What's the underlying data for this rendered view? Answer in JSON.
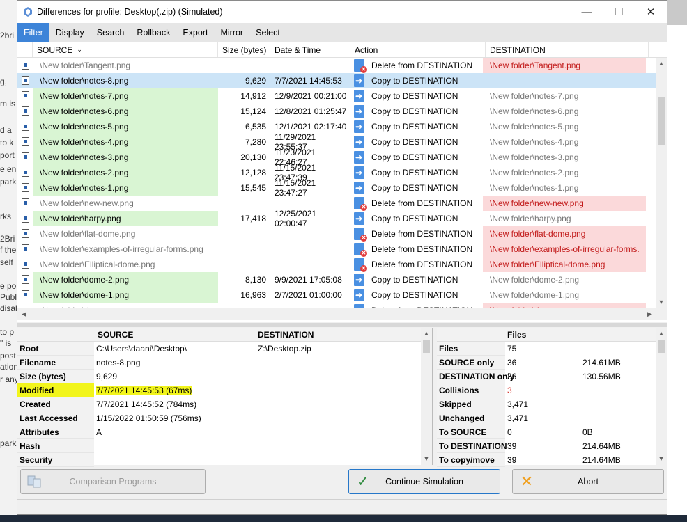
{
  "window": {
    "title": "Differences for profile: Desktop(.zip) (Simulated)",
    "minimize": "—",
    "maximize": "☐",
    "close": "✕"
  },
  "menu": [
    "Filter",
    "Display",
    "Search",
    "Rollback",
    "Export",
    "Mirror",
    "Select"
  ],
  "grid": {
    "headers": {
      "source": "SOURCE",
      "size": "Size (bytes)",
      "date": "Date & Time",
      "action": "Action",
      "destination": "DESTINATION"
    },
    "rows": [
      {
        "source": "\\New folder\\Tangent.png",
        "size": "",
        "date": "",
        "action": "Delete from DESTINATION",
        "dest": "\\New folder\\Tangent.png",
        "state": "del"
      },
      {
        "source": "\\New folder\\notes-8.png",
        "size": "9,629",
        "date": "7/7/2021 14:45:53",
        "action": "Copy to DESTINATION",
        "dest": "",
        "state": "sel"
      },
      {
        "source": "\\New folder\\notes-7.png",
        "size": "14,912",
        "date": "12/9/2021 00:21:00",
        "action": "Copy to DESTINATION",
        "dest": "\\New folder\\notes-7.png",
        "state": "left"
      },
      {
        "source": "\\New folder\\notes-6.png",
        "size": "15,124",
        "date": "12/8/2021 01:25:47",
        "action": "Copy to DESTINATION",
        "dest": "\\New folder\\notes-6.png",
        "state": "left"
      },
      {
        "source": "\\New folder\\notes-5.png",
        "size": "6,535",
        "date": "12/1/2021 02:17:40",
        "action": "Copy to DESTINATION",
        "dest": "\\New folder\\notes-5.png",
        "state": "left"
      },
      {
        "source": "\\New folder\\notes-4.png",
        "size": "7,280",
        "date": "11/29/2021 23:55:37",
        "action": "Copy to DESTINATION",
        "dest": "\\New folder\\notes-4.png",
        "state": "left"
      },
      {
        "source": "\\New folder\\notes-3.png",
        "size": "20,130",
        "date": "11/23/2021 22:46:27",
        "action": "Copy to DESTINATION",
        "dest": "\\New folder\\notes-3.png",
        "state": "left"
      },
      {
        "source": "\\New folder\\notes-2.png",
        "size": "12,128",
        "date": "11/15/2021 23:47:39",
        "action": "Copy to DESTINATION",
        "dest": "\\New folder\\notes-2.png",
        "state": "left"
      },
      {
        "source": "\\New folder\\notes-1.png",
        "size": "15,545",
        "date": "11/15/2021 23:47:27",
        "action": "Copy to DESTINATION",
        "dest": "\\New folder\\notes-1.png",
        "state": "left"
      },
      {
        "source": "\\New folder\\new-new.png",
        "size": "",
        "date": "",
        "action": "Delete from DESTINATION",
        "dest": "\\New folder\\new-new.png",
        "state": "del"
      },
      {
        "source": "\\New folder\\harpy.png",
        "size": "17,418",
        "date": "12/25/2021 02:00:47",
        "action": "Copy to DESTINATION",
        "dest": "\\New folder\\harpy.png",
        "state": "left"
      },
      {
        "source": "\\New folder\\flat-dome.png",
        "size": "",
        "date": "",
        "action": "Delete from DESTINATION",
        "dest": "\\New folder\\flat-dome.png",
        "state": "del"
      },
      {
        "source": "\\New folder\\examples-of-irregular-forms.png",
        "size": "",
        "date": "",
        "action": "Delete from DESTINATION",
        "dest": "\\New folder\\examples-of-irregular-forms.",
        "state": "del"
      },
      {
        "source": "\\New folder\\Elliptical-dome.png",
        "size": "",
        "date": "",
        "action": "Delete from DESTINATION",
        "dest": "\\New folder\\Elliptical-dome.png",
        "state": "del"
      },
      {
        "source": "\\New folder\\dome-2.png",
        "size": "8,130",
        "date": "9/9/2021 17:05:08",
        "action": "Copy to DESTINATION",
        "dest": "\\New folder\\dome-2.png",
        "state": "left"
      },
      {
        "source": "\\New folder\\dome-1.png",
        "size": "16,963",
        "date": "2/7/2021 01:00:00",
        "action": "Copy to DESTINATION",
        "dest": "\\New folder\\dome-1.png",
        "state": "left"
      },
      {
        "source": "\\New folder\\dome.png",
        "size": "",
        "date": "",
        "action": "Delete from DESTINATION",
        "dest": "\\New folder\\dome.png",
        "state": "del"
      }
    ]
  },
  "properties": {
    "headers": {
      "source": "SOURCE",
      "destination": "DESTINATION"
    },
    "rows": [
      {
        "label": "Root",
        "source": "C:\\Users\\daani\\Desktop\\",
        "dest": "Z:\\Desktop.zip"
      },
      {
        "label": "Filename",
        "source": "notes-8.png",
        "dest": ""
      },
      {
        "label": "Size (bytes)",
        "source": "9,629",
        "dest": ""
      },
      {
        "label": "Modified",
        "source": "7/7/2021 14:45:53 (67ms)",
        "dest": ""
      },
      {
        "label": "Created",
        "source": "7/7/2021 14:45:52 (784ms)",
        "dest": ""
      },
      {
        "label": "Last Accessed",
        "source": "1/15/2022 01:50:59 (756ms)",
        "dest": ""
      },
      {
        "label": "Attributes",
        "source": "A",
        "dest": ""
      },
      {
        "label": "Hash",
        "source": "",
        "dest": ""
      },
      {
        "label": "Security",
        "source": "",
        "dest": ""
      }
    ]
  },
  "stats": {
    "header": "Files",
    "rows": [
      {
        "label": "Files",
        "v1": "75",
        "v2": ""
      },
      {
        "label": "SOURCE only",
        "v1": "36",
        "v2": "214.61MB"
      },
      {
        "label": "DESTINATION only",
        "v1": "36",
        "v2": "130.56MB"
      },
      {
        "label": "Collisions",
        "v1": "3",
        "v2": ""
      },
      {
        "label": "Skipped",
        "v1": "3,471",
        "v2": ""
      },
      {
        "label": "Unchanged",
        "v1": "3,471",
        "v2": ""
      },
      {
        "label": "To SOURCE",
        "v1": "0",
        "v2": "0B"
      },
      {
        "label": "To DESTINATION",
        "v1": "39",
        "v2": "214.64MB"
      },
      {
        "label": "To copy/move",
        "v1": "39",
        "v2": "214.64MB"
      }
    ]
  },
  "buttons": {
    "comparison": "Comparison Programs",
    "continue": "Continue Simulation",
    "abort": "Abort"
  },
  "colors": {
    "accent": "#3d84d8",
    "source_only": "#d9f5d3",
    "delete": "#fbd9da",
    "highlight": "#f2f51c"
  }
}
